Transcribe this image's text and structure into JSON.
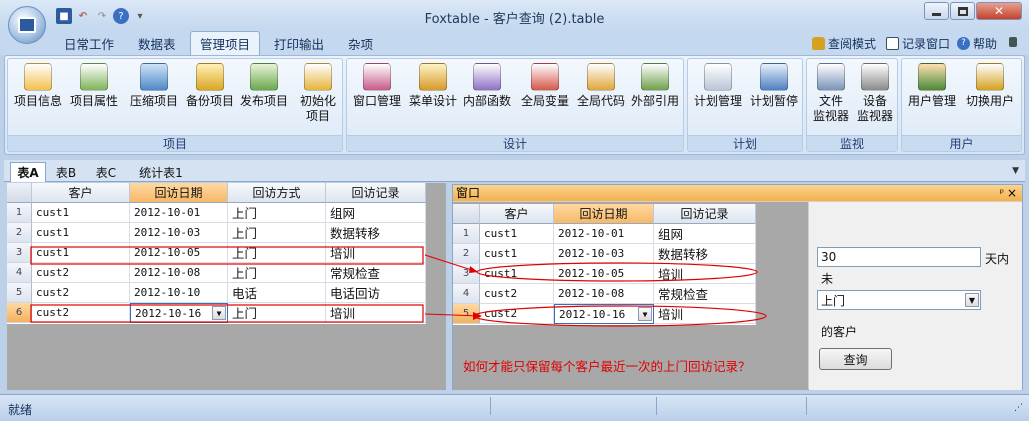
{
  "window": {
    "title": "Foxtable - 客户查询 (2).table"
  },
  "ribbon_tabs": [
    "日常工作",
    "数据表",
    "管理项目",
    "打印输出",
    "杂项"
  ],
  "ribbon_links": {
    "query_mode": "查阅模式",
    "record_window": "记录窗口",
    "help": "帮助"
  },
  "groups": [
    {
      "label": "项目",
      "buttons": [
        "项目信息",
        "项目属性",
        "压缩项目",
        "备份项目",
        "发布项目",
        "初始化\n项目"
      ]
    },
    {
      "label": "设计",
      "buttons": [
        "窗口管理",
        "菜单设计",
        "内部函数",
        "全局变量",
        "全局代码",
        "外部引用"
      ]
    },
    {
      "label": "计划",
      "buttons": [
        "计划管理",
        "计划暂停"
      ]
    },
    {
      "label": "监视",
      "buttons": [
        "文件\n监视器",
        "设备\n监视器"
      ]
    },
    {
      "label": "用户",
      "buttons": [
        "用户管理",
        "切换用户"
      ]
    }
  ],
  "doc_tabs": [
    "表A",
    "表B",
    "表C",
    "统计表1"
  ],
  "tableA": {
    "columns": [
      "客户",
      "回访日期",
      "回访方式",
      "回访记录"
    ],
    "rows": [
      [
        "cust1",
        "2012-10-01",
        "上门",
        "组网"
      ],
      [
        "cust1",
        "2012-10-03",
        "上门",
        "数据转移"
      ],
      [
        "cust1",
        "2012-10-05",
        "上门",
        "培训"
      ],
      [
        "cust2",
        "2012-10-08",
        "上门",
        "常规检查"
      ],
      [
        "cust2",
        "2012-10-10",
        "电话",
        "电话回访"
      ],
      [
        "cust2",
        "2012-10-16",
        "上门",
        "培训"
      ]
    ]
  },
  "panel": {
    "title": "窗口",
    "pin": "ᵖ",
    "close": "×",
    "tableB": {
      "columns": [
        "客户",
        "回访日期",
        "回访记录"
      ],
      "rows": [
        [
          "cust1",
          "2012-10-01",
          "组网"
        ],
        [
          "cust1",
          "2012-10-03",
          "数据转移"
        ],
        [
          "cust1",
          "2012-10-05",
          "培训"
        ],
        [
          "cust2",
          "2012-10-08",
          "常规检查"
        ],
        [
          "cust2",
          "2012-10-16",
          "培训"
        ]
      ]
    },
    "days_value": "30",
    "days_label": "天内",
    "not_label": "未",
    "method_value": "上门",
    "customer_label": "的客户",
    "query_button": "查询",
    "question": "如何才能只保留每个客户最近一次的上门回访记录？"
  },
  "status": {
    "text": "就绪"
  },
  "colors": {
    "annotation": "#e00000",
    "selected_header": "#f7b868"
  }
}
